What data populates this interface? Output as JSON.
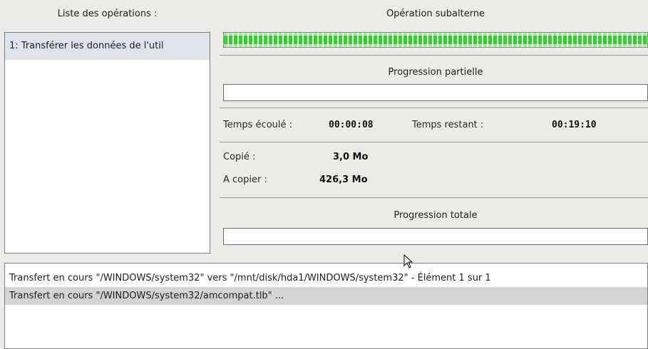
{
  "operations": {
    "header": "Liste des opérations :",
    "items": [
      "1: Transférer les données de l'util"
    ]
  },
  "sub_operation": {
    "header": "Opération subalterne",
    "progress_percent": 100
  },
  "partial": {
    "header": "Progression partielle",
    "progress_percent": 0
  },
  "times": {
    "elapsed_label": "Temps écoulé :",
    "elapsed_value": "00:00:08",
    "remaining_label": "Temps restant :",
    "remaining_value": "00:19:10"
  },
  "sizes": {
    "copied_label": "Copié :",
    "copied_value": "3,0 Mo",
    "to_copy_label": "A copier :",
    "to_copy_value": "426,3 Mo"
  },
  "total": {
    "header": "Progression totale",
    "progress_percent": 0
  },
  "log": {
    "lines": [
      "Transfert en cours \"/WINDOWS/system32\" vers \"/mnt/disk/hda1/WINDOWS/system32\" - Élément 1 sur 1",
      "Transfert en cours \"/WINDOWS/system32/amcompat.tlb\" ..."
    ],
    "selected_index": 1
  },
  "colors": {
    "progress_green": "#3ec93a",
    "background": "#ecebe8"
  }
}
